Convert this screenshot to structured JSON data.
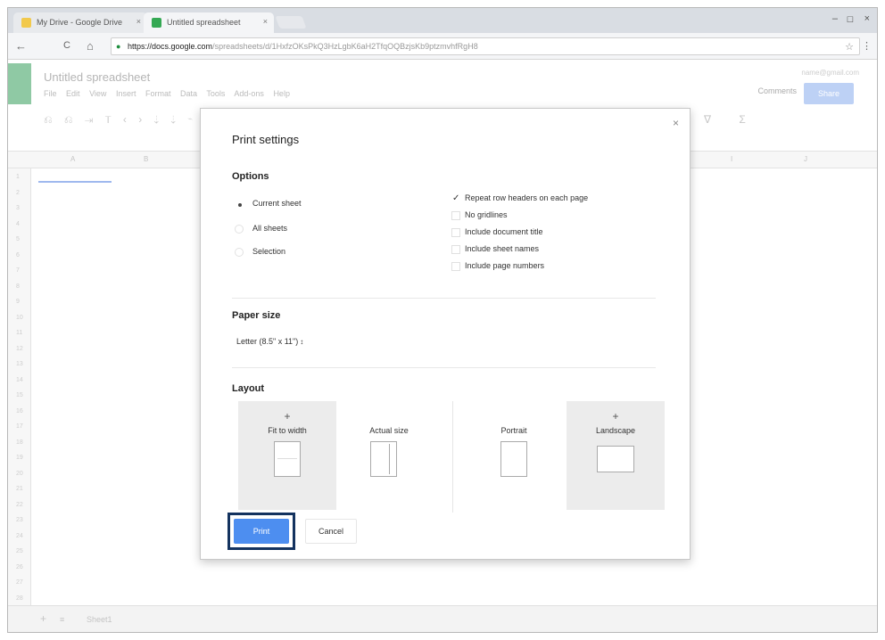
{
  "browser": {
    "tabs": [
      {
        "title": "My Drive - Google Drive",
        "close": "×"
      },
      {
        "title": "Untitled spreadsheet",
        "close": "×"
      }
    ],
    "window_controls": {
      "minimize": "–",
      "maximize": "☐",
      "close": "×"
    },
    "nav": {
      "back": "←",
      "reload": "C",
      "home": "⌂"
    },
    "url_domain": "https://docs.google.com",
    "url_rest": "/spreadsheets/d/1HxfzOKsPkQ3HzLgbK6aH2TfqOQBzjsKb9ptzmvhfRgH8",
    "star": "☆",
    "menu": "⋮"
  },
  "sheet": {
    "title": "Untitled spreadsheet",
    "menu": [
      "File",
      "Edit",
      "View",
      "Insert",
      "Format",
      "Data",
      "Tools",
      "Add-ons",
      "Help"
    ],
    "user": "name@gmail.com",
    "comments": "Comments",
    "share": "Share",
    "toolbar_left": "⎌ ⎌ ⇥ 𝖳 ‹ › ⇣ ⇣ ⌁",
    "toolbar_right": "∇ Σ",
    "columns": [
      "A",
      "B",
      "",
      "",
      "",
      "",
      "",
      "",
      "I",
      "J"
    ],
    "rows": [
      "1",
      "2",
      "3",
      "4",
      "5",
      "6",
      "7",
      "8",
      "9",
      "10",
      "11",
      "12",
      "13",
      "14",
      "15",
      "16",
      "17",
      "18",
      "19",
      "20",
      "21",
      "22",
      "23",
      "24",
      "25",
      "26",
      "27",
      "28"
    ],
    "sheet_tab": "Sheet1",
    "add_sheet": "+",
    "sheets_menu": "≡"
  },
  "dialog": {
    "title": "Print settings",
    "close": "×",
    "options_title": "Options",
    "print_scope": [
      {
        "label": "Current sheet",
        "selected": true
      },
      {
        "label": "All sheets",
        "selected": false
      },
      {
        "label": "Selection",
        "selected": false
      }
    ],
    "checkboxes": [
      {
        "label": "Repeat row headers on each page",
        "checked": true
      },
      {
        "label": "No gridlines",
        "checked": false
      },
      {
        "label": "Include document title",
        "checked": false
      },
      {
        "label": "Include sheet names",
        "checked": false
      },
      {
        "label": "Include page numbers",
        "checked": false
      }
    ],
    "paper_size_title": "Paper size",
    "paper_size_value": "Letter (8.5\" x 11\")",
    "paper_size_arrow": "↕",
    "layout_title": "Layout",
    "fit_options": [
      {
        "label": "Fit to width",
        "selected": true,
        "mark": "+"
      },
      {
        "label": "Actual size",
        "selected": false,
        "mark": ""
      }
    ],
    "orientation_options": [
      {
        "label": "Portrait",
        "selected": false,
        "mark": ""
      },
      {
        "label": "Landscape",
        "selected": true,
        "mark": "+"
      }
    ],
    "print_label": "Print",
    "cancel_label": "Cancel",
    "accent_color": "#4d8ef0"
  }
}
